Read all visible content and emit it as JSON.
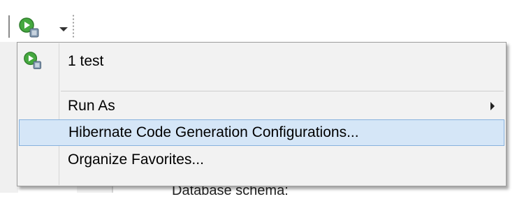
{
  "toolbar": {
    "run_button_icon": "run-config-icon",
    "dropdown_icon": "chevron-down-icon"
  },
  "menu": {
    "items": [
      {
        "label": "1 test",
        "icon": "run-config-icon"
      },
      {
        "label": "Run As",
        "submenu_icon": "chevron-right-icon"
      },
      {
        "label": "Hibernate Code Generation Configurations...",
        "state": "highlighted"
      },
      {
        "label": "Organize Favorites..."
      }
    ]
  },
  "background": {
    "clipped_text": "Database schema:"
  },
  "colors": {
    "menu_background": "#f2f2f2",
    "highlight_fill": "#d5e6f7",
    "highlight_border": "#87b2de",
    "icon_green": "#3fa53b"
  }
}
